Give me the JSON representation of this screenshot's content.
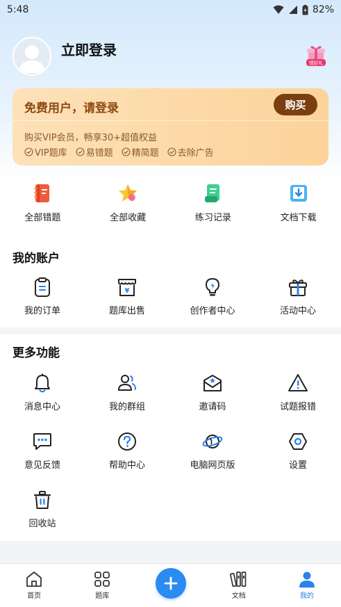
{
  "status_bar": {
    "time": "5:48",
    "battery": "82%"
  },
  "profile": {
    "login_label": "立即登录",
    "gift_badge_text": "领好礼"
  },
  "vip_card": {
    "title": "免费用户，请登录",
    "buy_label": "购买",
    "description": "购买VIP会员，畅享30+超值权益",
    "perks": [
      "VIP题库",
      "易错题",
      "精简题",
      "去除广告"
    ]
  },
  "quick_actions": [
    {
      "label": "全部错题",
      "icon": "wrong-questions-book-icon"
    },
    {
      "label": "全部收藏",
      "icon": "star-favorites-icon"
    },
    {
      "label": "练习记录",
      "icon": "practice-record-icon"
    },
    {
      "label": "文档下载",
      "icon": "document-download-icon"
    }
  ],
  "account": {
    "title": "我的账户",
    "items": [
      {
        "label": "我的订单",
        "icon": "order-icon"
      },
      {
        "label": "题库出售",
        "icon": "shop-icon"
      },
      {
        "label": "创作者中心",
        "icon": "lightbulb-icon"
      },
      {
        "label": "活动中心",
        "icon": "gift-icon"
      }
    ]
  },
  "more": {
    "title": "更多功能",
    "items": [
      {
        "label": "消息中心",
        "icon": "bell-icon"
      },
      {
        "label": "我的群组",
        "icon": "group-icon"
      },
      {
        "label": "邀请码",
        "icon": "invite-mail-icon"
      },
      {
        "label": "试题报错",
        "icon": "warning-icon"
      },
      {
        "label": "意见反馈",
        "icon": "feedback-icon"
      },
      {
        "label": "帮助中心",
        "icon": "help-icon"
      },
      {
        "label": "电脑网页版",
        "icon": "planet-web-icon"
      },
      {
        "label": "设置",
        "icon": "settings-icon"
      },
      {
        "label": "回收站",
        "icon": "trash-icon"
      }
    ]
  },
  "bottom_nav": [
    {
      "label": "首页",
      "icon": "home-icon"
    },
    {
      "label": "题库",
      "icon": "grid-icon"
    },
    {
      "label": "",
      "icon": "plus-icon"
    },
    {
      "label": "文档",
      "icon": "books-icon"
    },
    {
      "label": "我的",
      "icon": "user-icon",
      "active": true
    }
  ],
  "colors": {
    "accent": "#2a8bf2",
    "vip_text": "#8a4b12",
    "vip_button": "#7a3e10"
  }
}
